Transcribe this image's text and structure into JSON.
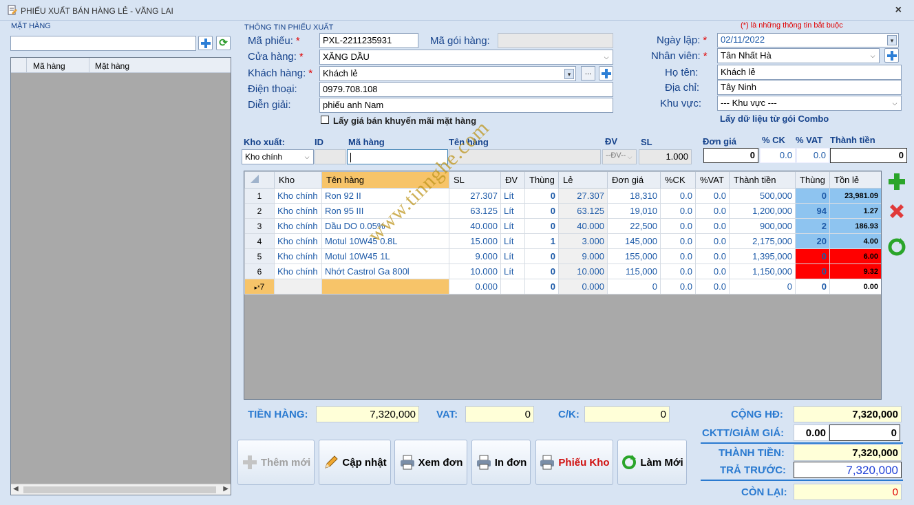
{
  "window": {
    "title": "PHIẾU XUẤT BÁN HÀNG LẺ - VÃNG LAI",
    "close": "×"
  },
  "left": {
    "group_title": "MẶT HÀNG",
    "search_value": "",
    "columns": [
      "Mã hàng",
      "Mặt hàng"
    ]
  },
  "info": {
    "group_title": "THÔNG TIN PHIẾU XUẤT",
    "required_note": "(*) là những thông tin bắt buộc",
    "ma_phieu_label": "Mã phiếu:",
    "ma_phieu_value": "PXL-2211235931",
    "ma_goi_label": "Mã gói hàng:",
    "ma_goi_value": "",
    "cua_hang_label": "Cửa hàng:",
    "cua_hang_value": "XĂNG DẦU",
    "khach_hang_label": "Khách hàng:",
    "khach_hang_value": "Khách lẻ",
    "ellipsis": "...",
    "dien_thoai_label": "Điện thoại:",
    "dien_thoai_value": "0979.708.108",
    "dien_giai_label": "Diễn giải:",
    "dien_giai_value": "phiếu anh Nam",
    "khuyen_mai_label": "Lấy giá bán khuyến mãi mặt hàng",
    "ngay_lap_label": "Ngày lập:",
    "ngay_lap_value": "02/11/2022",
    "nhan_vien_label": "Nhân viên:",
    "nhan_vien_value": "Tân Nhất Hà",
    "ho_ten_label": "Họ tên:",
    "ho_ten_value": "Khách lẻ",
    "dia_chi_label": "Địa chỉ:",
    "dia_chi_value": "Tây Ninh",
    "khu_vuc_label": "Khu vực:",
    "khu_vuc_value": "--- Khu vực ---",
    "combo_label": "Lấy dữ liệu từ gói Combo",
    "star": "*"
  },
  "entry": {
    "kho_xuat_label": "Kho xuất:",
    "id_label": "ID",
    "ma_hang_label": "Mã hàng",
    "ten_hang_label": "Tên hàng",
    "dv_label": "ĐV",
    "sl_label": "SL",
    "don_gia_label": "Đơn giá",
    "ck_label": "% CK",
    "vat_label": "% VAT",
    "thanh_tien_label": "Thành tiền",
    "kho_value": "Kho chính",
    "dv_value": "--ĐV--",
    "sl_value": "1.000",
    "don_gia_value": "0",
    "ck_value": "0.0",
    "vat_value": "0.0",
    "thanh_tien_value": "0"
  },
  "grid": {
    "columns": [
      "",
      "Kho",
      "Tên hàng",
      "SL",
      "ĐV",
      "Thùng",
      "Lẻ",
      "Đơn giá",
      "%CK",
      "%VAT",
      "Thành tiền",
      "Thùng",
      "Tồn lẻ"
    ],
    "rows": [
      {
        "no": "1",
        "kho": "Kho chính",
        "ten": "Ron 92 II",
        "sl": "27.307",
        "dv": "Lít",
        "thung": "0",
        "le": "27.307",
        "don_gia": "18,310",
        "ck": "0.0",
        "vat": "0.0",
        "thanh_tien": "500,000",
        "thung2": "0",
        "ton": "23,981.09",
        "red": false
      },
      {
        "no": "2",
        "kho": "Kho chính",
        "ten": "Ron 95 III",
        "sl": "63.125",
        "dv": "Lít",
        "thung": "0",
        "le": "63.125",
        "don_gia": "19,010",
        "ck": "0.0",
        "vat": "0.0",
        "thanh_tien": "1,200,000",
        "thung2": "94",
        "ton": "1.27",
        "red": false
      },
      {
        "no": "3",
        "kho": "Kho chính",
        "ten": "Dầu DO 0.05%",
        "sl": "40.000",
        "dv": "Lít",
        "thung": "0",
        "le": "40.000",
        "don_gia": "22,500",
        "ck": "0.0",
        "vat": "0.0",
        "thanh_tien": "900,000",
        "thung2": "2",
        "ton": "186.93",
        "red": false
      },
      {
        "no": "4",
        "kho": "Kho chính",
        "ten": "Motul 10W45 0.8L",
        "sl": "15.000",
        "dv": "Lít",
        "thung": "1",
        "le": "3.000",
        "don_gia": "145,000",
        "ck": "0.0",
        "vat": "0.0",
        "thanh_tien": "2,175,000",
        "thung2": "20",
        "ton": "4.00",
        "red": false
      },
      {
        "no": "5",
        "kho": "Kho chính",
        "ten": "Motul 10W45 1L",
        "sl": "9.000",
        "dv": "Lít",
        "thung": "0",
        "le": "9.000",
        "don_gia": "155,000",
        "ck": "0.0",
        "vat": "0.0",
        "thanh_tien": "1,395,000",
        "thung2": "0",
        "ton": "6.00",
        "red": true
      },
      {
        "no": "6",
        "kho": "Kho chính",
        "ten": "Nhớt Castrol Ga 800l",
        "sl": "10.000",
        "dv": "Lít",
        "thung": "0",
        "le": "10.000",
        "don_gia": "115,000",
        "ck": "0.0",
        "vat": "0.0",
        "thanh_tien": "1,150,000",
        "thung2": "0",
        "ton": "9.32",
        "red": true
      }
    ],
    "new_row": {
      "no": "7",
      "sl": "0.000",
      "thung": "0",
      "le": "0.000",
      "don_gia": "0",
      "ck": "0.0",
      "vat": "0.0",
      "thanh_tien": "0",
      "thung2": "0",
      "ton": "0.00"
    }
  },
  "totals": {
    "tien_hang_label": "TIỀN HÀNG:",
    "tien_hang_value": "7,320,000",
    "vat_label": "VAT:",
    "vat_value": "0",
    "ck_label": "C/K:",
    "ck_value": "0",
    "cong_hd_label": "CỘNG HĐ:",
    "cong_hd_value": "7,320,000",
    "ckgg_label": "CKTT/GIẢM GIÁ:",
    "ckgg_pct": "0.00",
    "ckgg_value": "0",
    "thanh_tien_label": "THÀNH TIỀN:",
    "thanh_tien_value": "7,320,000",
    "tra_truoc_label": "TRẢ TRƯỚC:",
    "tra_truoc_value": "7,320,000",
    "con_lai_label": "CÒN LẠI:",
    "con_lai_value": "0"
  },
  "buttons": {
    "them_moi": "Thêm mới",
    "cap_nhat": "Cập nhật",
    "xem_don": "Xem đơn",
    "in_don": "In đơn",
    "phieu_kho": "Phiếu Kho",
    "lam_moi": "Làm Mới"
  },
  "watermark": "www.tinnghe.com"
}
